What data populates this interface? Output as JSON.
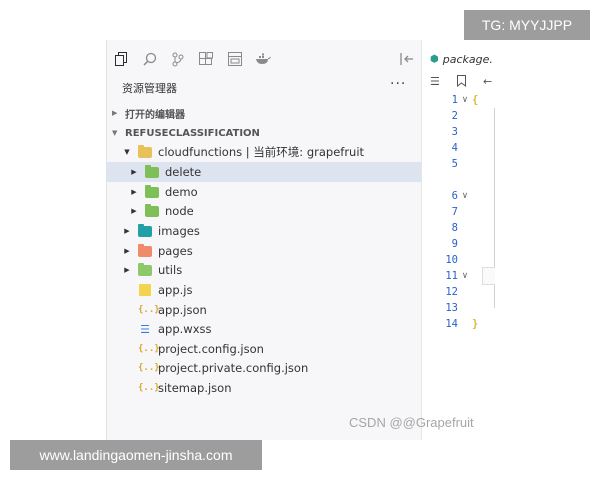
{
  "explorer": {
    "title": "资源管理器",
    "more": "···",
    "open_editors": "打开的编辑器",
    "project": "REFUSECLASSIFICATION",
    "activity_icons": [
      "files-icon",
      "search-icon",
      "source-control-icon",
      "extensions-icon",
      "cloud-icon",
      "docker-icon",
      "split-left-icon"
    ],
    "tree": [
      {
        "label": "cloudfunctions | 当前环境: grapefruit",
        "icon": "folder-open",
        "color": "#e8c15a"
      },
      {
        "label": "delete",
        "icon": "folder",
        "color": "#7fbf58"
      },
      {
        "label": "demo",
        "icon": "folder",
        "color": "#7fbf58"
      },
      {
        "label": "node",
        "icon": "folder",
        "color": "#7fbf58"
      },
      {
        "label": "images",
        "icon": "folder",
        "color": "#22a0a8"
      },
      {
        "label": "pages",
        "icon": "folder",
        "color": "#ef8a6a"
      },
      {
        "label": "utils",
        "icon": "folder",
        "color": "#8fc86a"
      },
      {
        "label": "app.js",
        "icon": "js"
      },
      {
        "label": "app.json",
        "icon": "json"
      },
      {
        "label": "app.wxss",
        "icon": "wxss"
      },
      {
        "label": "project.config.json",
        "icon": "json"
      },
      {
        "label": "project.private.config.json",
        "icon": "json"
      },
      {
        "label": "sitemap.json",
        "icon": "json"
      }
    ]
  },
  "editor": {
    "tab_label": "package.",
    "line_numbers": [
      "1",
      "2",
      "3",
      "4",
      "5",
      "6",
      "7",
      "8",
      "9",
      "10",
      "11",
      "12",
      "13",
      "14"
    ]
  },
  "overlays": {
    "tg": "TG: MYYJJPP",
    "url": "www.landingaomen-jinsha.com",
    "watermark": "CSDN @@Grapefruit"
  }
}
